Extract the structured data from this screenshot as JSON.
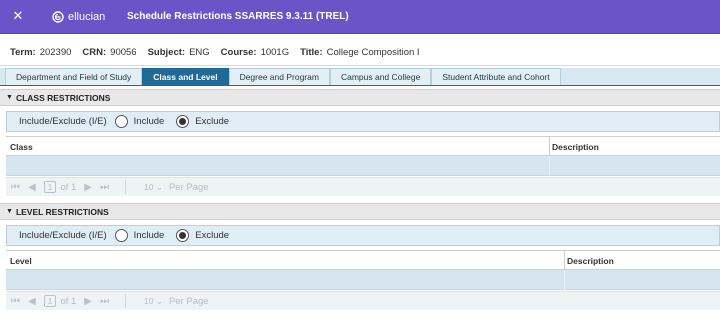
{
  "header": {
    "close_icon": "close-icon",
    "logo_text": "ellucian",
    "title": "Schedule Restrictions SSARRES 9.3.11 (TREL)"
  },
  "context": {
    "term_label": "Term:",
    "term_value": "202390",
    "crn_label": "CRN:",
    "crn_value": "90056",
    "subject_label": "Subject:",
    "subject_value": "ENG",
    "course_label": "Course:",
    "course_value": "1001G",
    "title_label": "Title:",
    "title_value": "College Composition I"
  },
  "tabs": [
    {
      "label": "Department and Field of Study",
      "active": false
    },
    {
      "label": "Class and Level",
      "active": true
    },
    {
      "label": "Degree and Program",
      "active": false
    },
    {
      "label": "Campus and College",
      "active": false
    },
    {
      "label": "Student Attribute and Cohort",
      "active": false
    }
  ],
  "class_section": {
    "header": "CLASS RESTRICTIONS",
    "ie_label": "Include/Exclude (I/E)",
    "include_label": "Include",
    "exclude_label": "Exclude",
    "selected": "Exclude",
    "columns": [
      "Class",
      "Description"
    ],
    "pager": {
      "page": "1",
      "of_text": "of 1",
      "per_page_value": "10",
      "per_page_label": "Per Page"
    }
  },
  "level_section": {
    "header": "LEVEL RESTRICTIONS",
    "ie_label": "Include/Exclude (I/E)",
    "include_label": "Include",
    "exclude_label": "Exclude",
    "selected": "Exclude",
    "columns": [
      "Level",
      "Description"
    ],
    "pager": {
      "page": "1",
      "of_text": "of 1",
      "per_page_value": "10",
      "per_page_label": "Per Page"
    }
  },
  "colors": {
    "banner": "#6a55c8",
    "active_tab": "#1f6a96",
    "row_fill": "#d6e6f0"
  }
}
